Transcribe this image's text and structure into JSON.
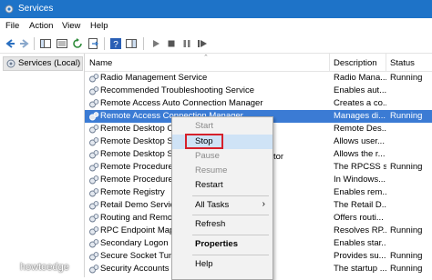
{
  "window": {
    "title": "Services"
  },
  "menu": [
    {
      "label": "File"
    },
    {
      "label": "Action"
    },
    {
      "label": "View"
    },
    {
      "label": "Help"
    }
  ],
  "left_pane": {
    "node_label": "Services (Local)"
  },
  "columns": {
    "name": "Name",
    "description": "Description",
    "status": "Status"
  },
  "rows": [
    {
      "name": "Radio Management Service",
      "desc": "Radio Mana...",
      "status": "Running"
    },
    {
      "name": "Recommended Troubleshooting Service",
      "desc": "Enables aut...",
      "status": ""
    },
    {
      "name": "Remote Access Auto Connection Manager",
      "desc": "Creates a co...",
      "status": ""
    },
    {
      "name": "Remote Access Connection Manager",
      "desc": "Manages di...",
      "status": "Running",
      "selected": true
    },
    {
      "name": "Remote Desktop Co",
      "desc": "Remote Des...",
      "status": ""
    },
    {
      "name": "Remote Desktop Se",
      "desc": "Allows user...",
      "status": ""
    },
    {
      "name": "Remote Desktop Se",
      "desc": "Allows the r...",
      "status": ""
    },
    {
      "name": "Remote Procedure C",
      "desc": "The RPCSS s...",
      "status": "Running"
    },
    {
      "name": "Remote Procedure C",
      "desc": "In Windows...",
      "status": ""
    },
    {
      "name": "Remote Registry",
      "desc": "Enables rem...",
      "status": ""
    },
    {
      "name": "Retail Demo Service",
      "desc": "The Retail D...",
      "status": ""
    },
    {
      "name": "Routing and Remote",
      "desc": "Offers routi...",
      "status": ""
    },
    {
      "name": "RPC Endpoint Mapp",
      "desc": "Resolves RP...",
      "status": "Running"
    },
    {
      "name": "Secondary Logon",
      "desc": "Enables star...",
      "status": ""
    },
    {
      "name": "Secure Socket Tunn",
      "desc": "Provides su...",
      "status": "Running"
    },
    {
      "name": "Security Accounts M",
      "desc": "The startup ...",
      "status": "Running"
    }
  ],
  "name_tail_under_menu": "tor",
  "context_menu": {
    "start": "Start",
    "stop": "Stop",
    "pause": "Pause",
    "resume": "Resume",
    "restart": "Restart",
    "all_tasks": "All Tasks",
    "refresh": "Refresh",
    "properties": "Properties",
    "help": "Help",
    "submenu_arrow": "›"
  },
  "watermark": {
    "text": "howtoedge"
  },
  "colors": {
    "titlebar": "#1e73c8",
    "selection": "#3b7bd4",
    "stop_highlight": "#d6202b"
  }
}
